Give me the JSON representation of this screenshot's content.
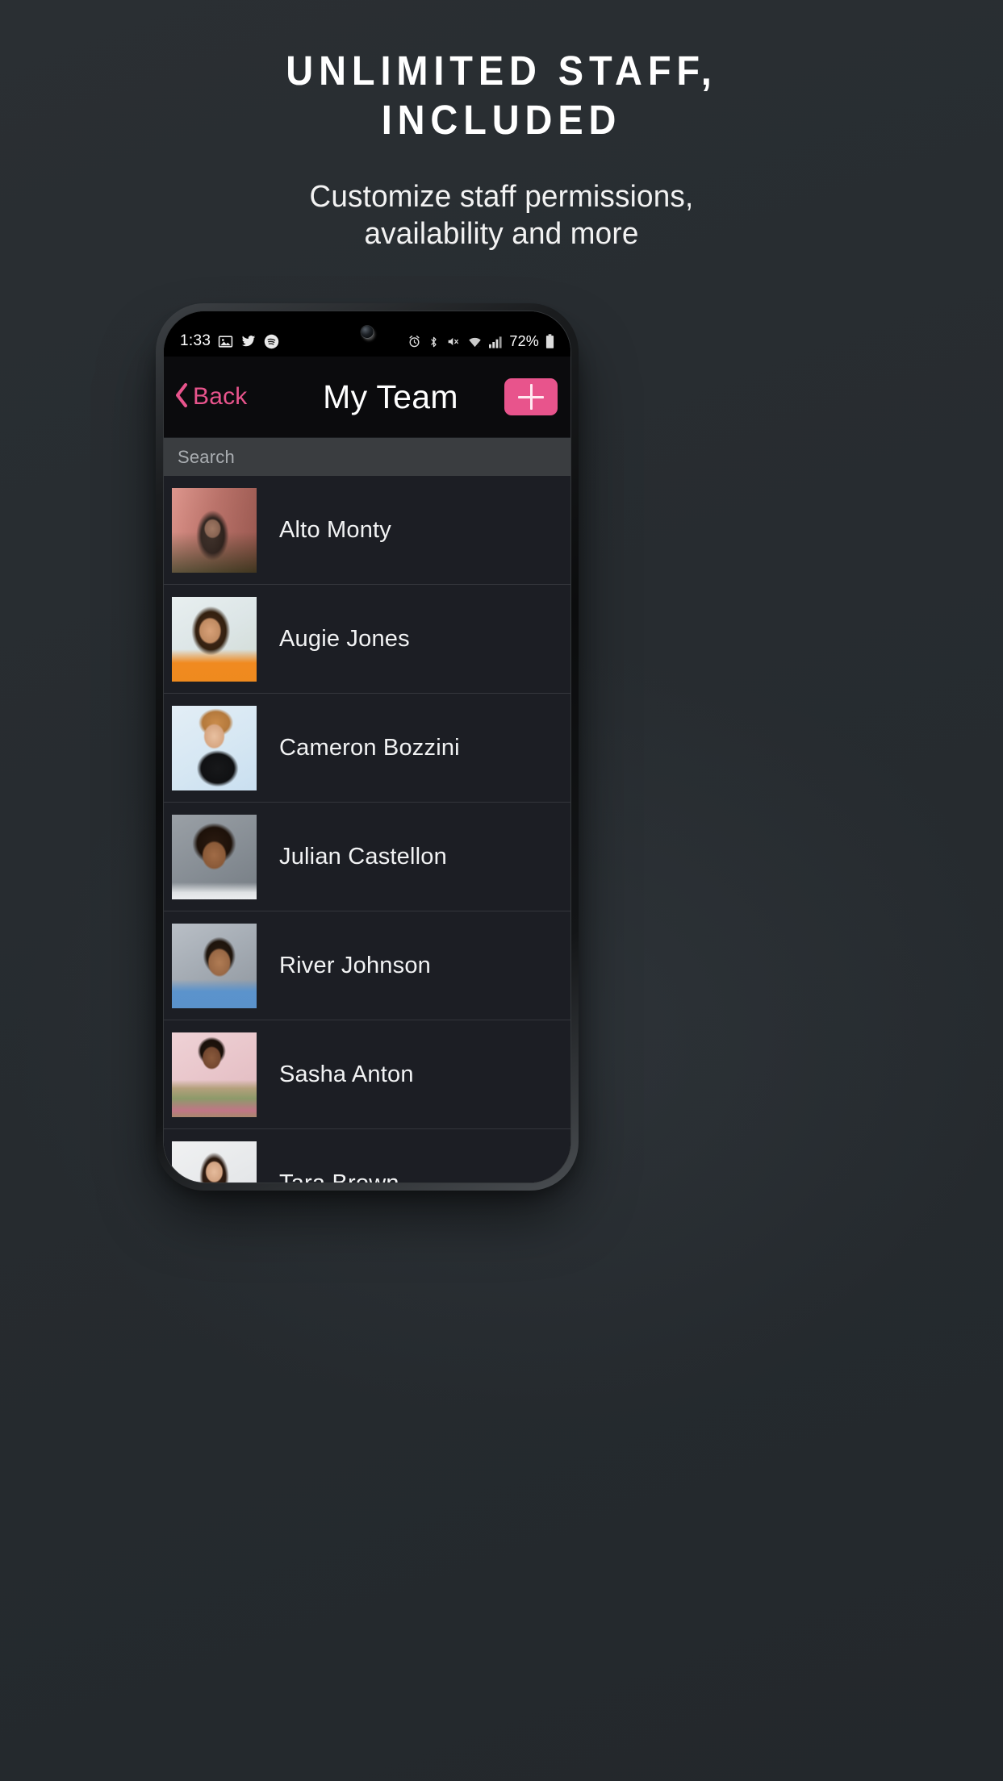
{
  "promo": {
    "title_line1": "UNLIMITED STAFF,",
    "title_line2": "INCLUDED",
    "subtitle_line1": "Customize staff permissions,",
    "subtitle_line2": "availability and more"
  },
  "colors": {
    "background": "#282d31",
    "accent_pink": "#e8548c",
    "screen_black": "#0a0a0c",
    "list_background": "#1c1e24",
    "search_background": "#3a3d40",
    "row_divider": "#34363c"
  },
  "phone": {
    "status_bar": {
      "time": "1:33",
      "battery_percent": "72%",
      "left_icons": [
        "photo-icon",
        "twitter-icon",
        "spotify-icon"
      ],
      "right_icons": [
        "alarm-icon",
        "bluetooth-icon",
        "mute-icon",
        "wifi-icon",
        "signal-icon",
        "battery-icon"
      ]
    },
    "nav_bar": {
      "back_label": "Back",
      "back_icon": "chevron-left-icon",
      "title": "My Team",
      "add_icon": "plus-icon"
    },
    "search": {
      "value": "",
      "placeholder": "Search"
    },
    "team": {
      "members": [
        {
          "name": "Alto Monty",
          "avatar": "person-dark-hair-red-building"
        },
        {
          "name": "Augie Jones",
          "avatar": "person-orange-top-smiling"
        },
        {
          "name": "Cameron Bozzini",
          "avatar": "person-short-hair-blue-bg"
        },
        {
          "name": "Julian Castellon",
          "avatar": "person-curly-hair-gray-bg"
        },
        {
          "name": "River Johnson",
          "avatar": "person-blue-shirt-street-bg"
        },
        {
          "name": "Sasha Anton",
          "avatar": "person-floral-top-pink-bg"
        },
        {
          "name": "Tara Brown",
          "avatar": "person-pink-sweater-white-bg"
        }
      ]
    }
  }
}
